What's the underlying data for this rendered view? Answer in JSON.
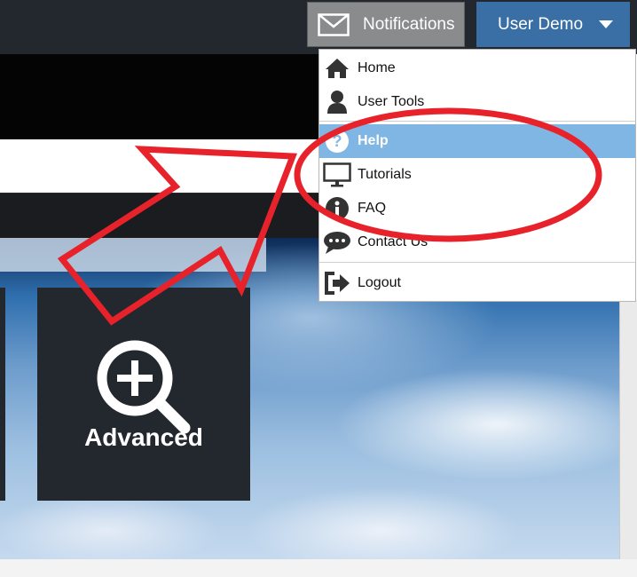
{
  "header": {
    "notifications_label": "Notifications",
    "user_label": "User Demo"
  },
  "menu": {
    "items": [
      {
        "label": "Home",
        "icon": "home-icon"
      },
      {
        "label": "User Tools",
        "icon": "user-icon"
      },
      {
        "label": "Help",
        "icon": "question-circle-icon",
        "active": true
      },
      {
        "label": "Tutorials",
        "icon": "monitor-icon"
      },
      {
        "label": "FAQ",
        "icon": "info-circle-icon"
      },
      {
        "label": "Contact Us",
        "icon": "chat-bubble-icon"
      },
      {
        "label": "Logout",
        "icon": "sign-out-icon"
      }
    ]
  },
  "tiles": {
    "advanced_label": "Advanced"
  },
  "colors": {
    "topbar": "#23272e",
    "user_button": "#3a6fa6",
    "notifications_button": "#8a8b8c",
    "menu_active": "#80b6e4",
    "annotation_red": "#e8222a",
    "tile_bg": "#23272e"
  }
}
